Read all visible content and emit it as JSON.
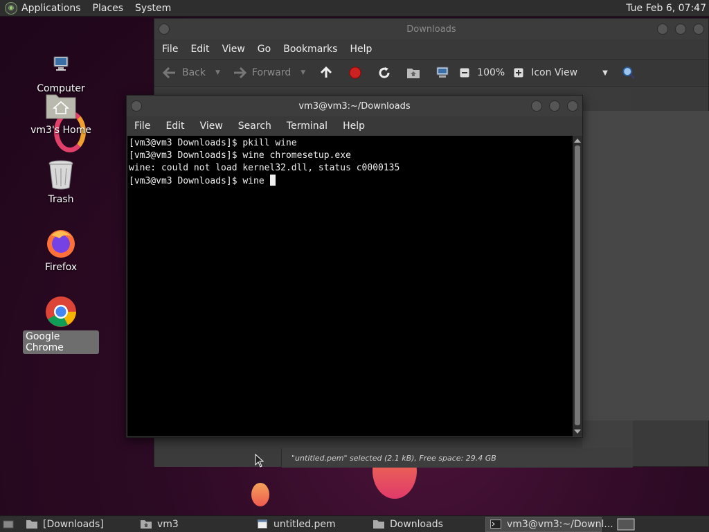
{
  "top_panel": {
    "menus": [
      "Applications",
      "Places",
      "System"
    ],
    "clock": "Tue Feb  6, 07:47"
  },
  "desktop": {
    "icons": [
      {
        "label": "Computer",
        "icon": "computer-icon"
      },
      {
        "label": "vm3's Home",
        "icon": "home-folder-icon"
      },
      {
        "label": "Trash",
        "icon": "trash-icon"
      },
      {
        "label": "Firefox",
        "icon": "firefox-icon"
      },
      {
        "label": "Google Chrome",
        "icon": "chrome-icon"
      }
    ]
  },
  "file_manager": {
    "title": "Downloads",
    "menus": [
      "File",
      "Edit",
      "View",
      "Go",
      "Bookmarks",
      "Help"
    ],
    "toolbar": {
      "back": "Back",
      "forward": "Forward",
      "zoom": "100%",
      "view_mode": "Icon View"
    },
    "status": "\"untitled.pem\" selected (2.1 kB), Free space: 29.4 GB"
  },
  "terminal": {
    "title": "vm3@vm3:~/Downloads",
    "menus": [
      "File",
      "Edit",
      "View",
      "Search",
      "Terminal",
      "Help"
    ],
    "lines": [
      "[vm3@vm3 Downloads]$ pkill wine",
      "[vm3@vm3 Downloads]$ wine chromesetup.exe",
      "wine: could not load kernel32.dll, status c0000135",
      "[vm3@vm3 Downloads]$ wine "
    ]
  },
  "taskbar": {
    "items": [
      {
        "label": "[Downloads]",
        "icon": "folder-icon"
      },
      {
        "label": "vm3",
        "icon": "home-folder-icon"
      },
      {
        "label": "untitled.pem",
        "icon": "text-file-icon"
      },
      {
        "label": "Downloads",
        "icon": "folder-icon"
      },
      {
        "label": "vm3@vm3:~/Downl...",
        "icon": "terminal-icon",
        "active": true
      }
    ]
  }
}
